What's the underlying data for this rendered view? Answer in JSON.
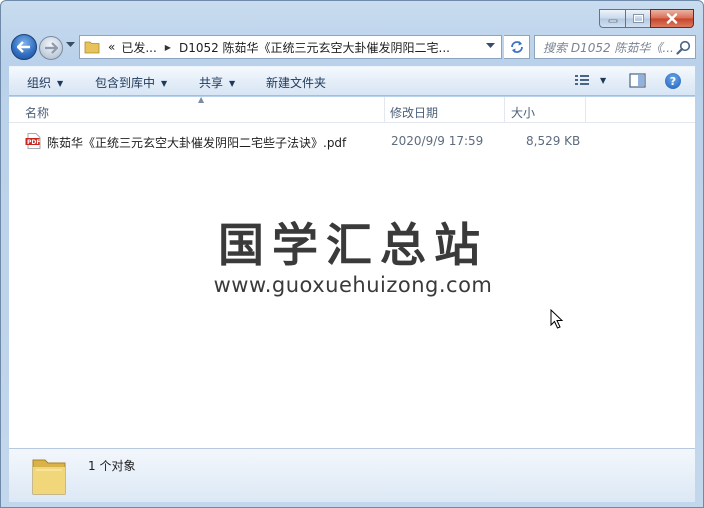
{
  "window": {
    "caption": {
      "minimize": "minimize-icon",
      "maximize": "maximize-icon",
      "close": "close-icon"
    }
  },
  "nav": {
    "back_icon": "back-arrow-icon",
    "forward_icon": "forward-arrow-icon",
    "address": {
      "overflow": "«",
      "segments": [
        "已发...",
        "D1052 陈茹华《正统三元玄空大卦催发阴阳二宅..."
      ]
    },
    "search": {
      "placeholder": "搜索 D1052 陈茹华《..."
    }
  },
  "toolbar": {
    "organize": "组织",
    "include_in_library": "包含到库中",
    "share": "共享",
    "new_folder": "新建文件夹",
    "help": "?"
  },
  "columns": {
    "name": "名称",
    "date_modified": "修改日期",
    "size": "大小"
  },
  "files": [
    {
      "icon": "pdf-file-icon",
      "name": "陈茹华《正统三元玄空大卦催发阴阳二宅些子法诀》.pdf",
      "date": "2020/9/9 17:59",
      "size": "8,529 KB"
    }
  ],
  "watermark": {
    "title": "国学汇总站",
    "url": "www.guoxuehuizong.com"
  },
  "details": {
    "count_text": "1 个对象"
  },
  "colors": {
    "frame": "#c3d7ec",
    "toolbar_text": "#1e395b",
    "header_text": "#4c607a",
    "watermark": "#3a3a3a",
    "close_button": "#c7442a"
  }
}
